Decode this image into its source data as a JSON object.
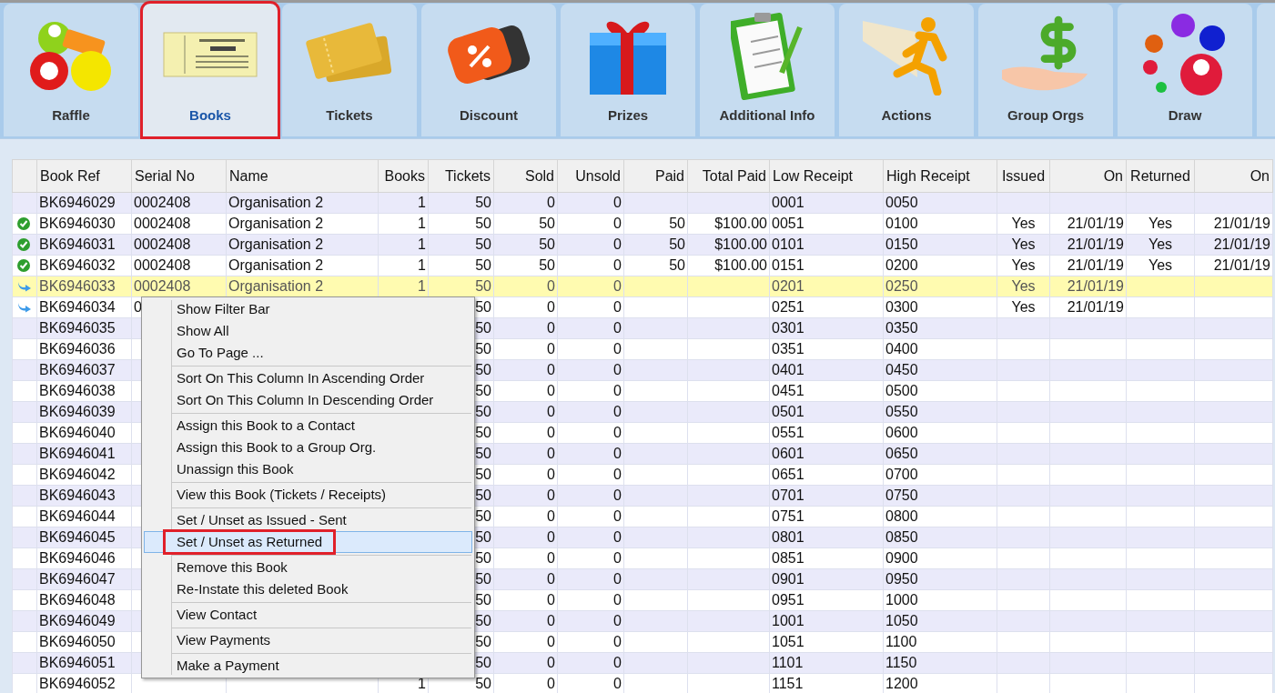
{
  "toolbar": {
    "tabs": [
      {
        "label": "Raffle",
        "kind": "raffle",
        "selected": false,
        "annotated": false
      },
      {
        "label": "Books",
        "kind": "books",
        "selected": true,
        "annotated": true
      },
      {
        "label": "Tickets",
        "kind": "tickets",
        "selected": false,
        "annotated": false
      },
      {
        "label": "Discount",
        "kind": "discount",
        "selected": false,
        "annotated": false
      },
      {
        "label": "Prizes",
        "kind": "prizes",
        "selected": false,
        "annotated": false
      },
      {
        "label": "Additional Info",
        "kind": "info",
        "selected": false,
        "annotated": false
      },
      {
        "label": "Actions",
        "kind": "actions",
        "selected": false,
        "annotated": false
      },
      {
        "label": "Group Orgs",
        "kind": "orgs",
        "selected": false,
        "annotated": false
      },
      {
        "label": "Draw",
        "kind": "draw",
        "selected": false,
        "annotated": false
      }
    ]
  },
  "table": {
    "columns": [
      "Book Ref",
      "Serial No",
      "Name",
      "Books",
      "Tickets",
      "Sold",
      "Unsold",
      "Paid",
      "Total Paid",
      "Low Receipt",
      "High Receipt",
      "Issued",
      "On",
      "Returned",
      "On"
    ],
    "rows": [
      {
        "selected": false,
        "cells": [
          "BK6946029",
          "0002408",
          "Organisation 2",
          "1",
          "50",
          "0",
          "0",
          null,
          null,
          "0001",
          "0050",
          null,
          null,
          null,
          null
        ]
      },
      {
        "kind": "returned",
        "selected": false,
        "cells": [
          "BK6946030",
          "0002408",
          "Organisation 2",
          "1",
          "50",
          "50",
          "0",
          "50",
          "$100.00",
          "0051",
          "0100",
          "Yes",
          "21/01/19",
          "Yes",
          "21/01/19"
        ]
      },
      {
        "kind": "returned",
        "selected": false,
        "cells": [
          "BK6946031",
          "0002408",
          "Organisation 2",
          "1",
          "50",
          "50",
          "0",
          "50",
          "$100.00",
          "0101",
          "0150",
          "Yes",
          "21/01/19",
          "Yes",
          "21/01/19"
        ]
      },
      {
        "kind": "returned",
        "selected": false,
        "cells": [
          "BK6946032",
          "0002408",
          "Organisation 2",
          "1",
          "50",
          "50",
          "0",
          "50",
          "$100.00",
          "0151",
          "0200",
          "Yes",
          "21/01/19",
          "Yes",
          "21/01/19"
        ]
      },
      {
        "kind": "issued",
        "selected": true,
        "cells": [
          "BK6946033",
          "0002408",
          "Organisation 2",
          "1",
          "50",
          "0",
          "0",
          null,
          null,
          "0201",
          "0250",
          "Yes",
          "21/01/19",
          null,
          null
        ]
      },
      {
        "kind": "issued",
        "selected": false,
        "cells": [
          "BK6946034",
          "0",
          null,
          null,
          "50",
          "0",
          "0",
          null,
          null,
          "0251",
          "0300",
          "Yes",
          "21/01/19",
          null,
          null
        ]
      },
      {
        "selected": false,
        "cells": [
          "BK6946035",
          null,
          null,
          null,
          "50",
          "0",
          "0",
          null,
          null,
          "0301",
          "0350",
          null,
          null,
          null,
          null
        ]
      },
      {
        "selected": false,
        "cells": [
          "BK6946036",
          null,
          null,
          null,
          "50",
          "0",
          "0",
          null,
          null,
          "0351",
          "0400",
          null,
          null,
          null,
          null
        ]
      },
      {
        "selected": false,
        "cells": [
          "BK6946037",
          null,
          null,
          null,
          "50",
          "0",
          "0",
          null,
          null,
          "0401",
          "0450",
          null,
          null,
          null,
          null
        ]
      },
      {
        "selected": false,
        "cells": [
          "BK6946038",
          null,
          null,
          null,
          "50",
          "0",
          "0",
          null,
          null,
          "0451",
          "0500",
          null,
          null,
          null,
          null
        ]
      },
      {
        "selected": false,
        "cells": [
          "BK6946039",
          null,
          null,
          null,
          "50",
          "0",
          "0",
          null,
          null,
          "0501",
          "0550",
          null,
          null,
          null,
          null
        ]
      },
      {
        "selected": false,
        "cells": [
          "BK6946040",
          null,
          null,
          null,
          "50",
          "0",
          "0",
          null,
          null,
          "0551",
          "0600",
          null,
          null,
          null,
          null
        ]
      },
      {
        "selected": false,
        "cells": [
          "BK6946041",
          null,
          null,
          null,
          "50",
          "0",
          "0",
          null,
          null,
          "0601",
          "0650",
          null,
          null,
          null,
          null
        ]
      },
      {
        "selected": false,
        "cells": [
          "BK6946042",
          null,
          null,
          null,
          "50",
          "0",
          "0",
          null,
          null,
          "0651",
          "0700",
          null,
          null,
          null,
          null
        ]
      },
      {
        "selected": false,
        "cells": [
          "BK6946043",
          null,
          null,
          null,
          "50",
          "0",
          "0",
          null,
          null,
          "0701",
          "0750",
          null,
          null,
          null,
          null
        ]
      },
      {
        "selected": false,
        "cells": [
          "BK6946044",
          null,
          null,
          null,
          "50",
          "0",
          "0",
          null,
          null,
          "0751",
          "0800",
          null,
          null,
          null,
          null
        ]
      },
      {
        "selected": false,
        "cells": [
          "BK6946045",
          null,
          null,
          null,
          "50",
          "0",
          "0",
          null,
          null,
          "0801",
          "0850",
          null,
          null,
          null,
          null
        ]
      },
      {
        "selected": false,
        "cells": [
          "BK6946046",
          null,
          null,
          null,
          "50",
          "0",
          "0",
          null,
          null,
          "0851",
          "0900",
          null,
          null,
          null,
          null
        ]
      },
      {
        "selected": false,
        "cells": [
          "BK6946047",
          null,
          null,
          null,
          "50",
          "0",
          "0",
          null,
          null,
          "0901",
          "0950",
          null,
          null,
          null,
          null
        ]
      },
      {
        "selected": false,
        "cells": [
          "BK6946048",
          null,
          null,
          null,
          "50",
          "0",
          "0",
          null,
          null,
          "0951",
          "1000",
          null,
          null,
          null,
          null
        ]
      },
      {
        "selected": false,
        "cells": [
          "BK6946049",
          null,
          null,
          null,
          "50",
          "0",
          "0",
          null,
          null,
          "1001",
          "1050",
          null,
          null,
          null,
          null
        ]
      },
      {
        "selected": false,
        "cells": [
          "BK6946050",
          null,
          null,
          null,
          "50",
          "0",
          "0",
          null,
          null,
          "1051",
          "1100",
          null,
          null,
          null,
          null
        ]
      },
      {
        "selected": false,
        "cells": [
          "BK6946051",
          null,
          null,
          null,
          "50",
          "0",
          "0",
          null,
          null,
          "1101",
          "1150",
          null,
          null,
          null,
          null
        ]
      },
      {
        "selected": false,
        "cells": [
          "BK6946052",
          null,
          null,
          "1",
          "50",
          "0",
          "0",
          null,
          null,
          "1151",
          "1200",
          null,
          null,
          null,
          null
        ]
      }
    ]
  },
  "context_menu": {
    "groups": [
      [
        {
          "label": "Show Filter Bar",
          "selected": false,
          "annotated": false
        },
        {
          "label": "Show All",
          "selected": false,
          "annotated": false
        },
        {
          "label": "Go To Page ...",
          "selected": false,
          "annotated": false
        }
      ],
      [
        {
          "label": "Sort On This Column In Ascending Order",
          "selected": false,
          "annotated": false
        },
        {
          "label": "Sort On This Column In Descending Order",
          "selected": false,
          "annotated": false
        }
      ],
      [
        {
          "label": "Assign this Book to a Contact",
          "selected": false,
          "annotated": false
        },
        {
          "label": "Assign this Book to a Group Org.",
          "selected": false,
          "annotated": false
        },
        {
          "label": "Unassign this Book",
          "selected": false,
          "annotated": false
        }
      ],
      [
        {
          "label": "View this Book (Tickets / Receipts)",
          "selected": false,
          "annotated": false
        }
      ],
      [
        {
          "label": "Set / Unset as Issued - Sent",
          "selected": false,
          "annotated": false
        },
        {
          "label": "Set / Unset as Returned",
          "selected": true,
          "annotated": true
        }
      ],
      [
        {
          "label": "Remove this Book",
          "selected": false,
          "annotated": false
        },
        {
          "label": "Re-Instate this deleted Book",
          "selected": false,
          "annotated": false
        }
      ],
      [
        {
          "label": "View Contact",
          "selected": false,
          "annotated": false
        }
      ],
      [
        {
          "label": "View Payments",
          "selected": false,
          "annotated": false
        }
      ],
      [
        {
          "label": "Make a Payment",
          "selected": false,
          "annotated": false
        }
      ]
    ]
  }
}
